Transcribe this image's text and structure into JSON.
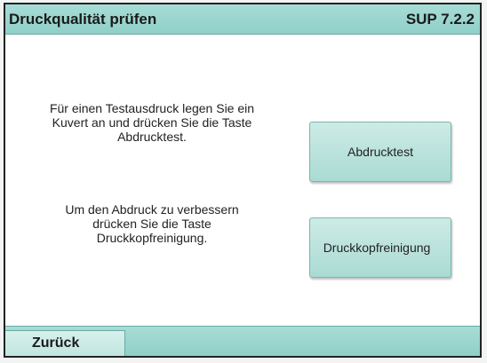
{
  "header": {
    "title": "Druckqualität prüfen",
    "version": "SUP 7.2.2"
  },
  "main": {
    "instruction_print_test": "Für einen Testausdruck legen Sie ein\nKuvert an und drücken Sie die Taste\nAbdrucktest.",
    "print_test_label": "Abdrucktest",
    "instruction_cleaning": "Um den Abdruck zu verbessern\ndrücken Sie die Taste\nDruckkopfreinigung.",
    "cleaning_label": "Druckkopfreinigung"
  },
  "footer": {
    "back_label": "Zurück"
  },
  "colors": {
    "bar": "#8fd0c8",
    "button": "#bfe5df",
    "background": "#ffffff"
  }
}
